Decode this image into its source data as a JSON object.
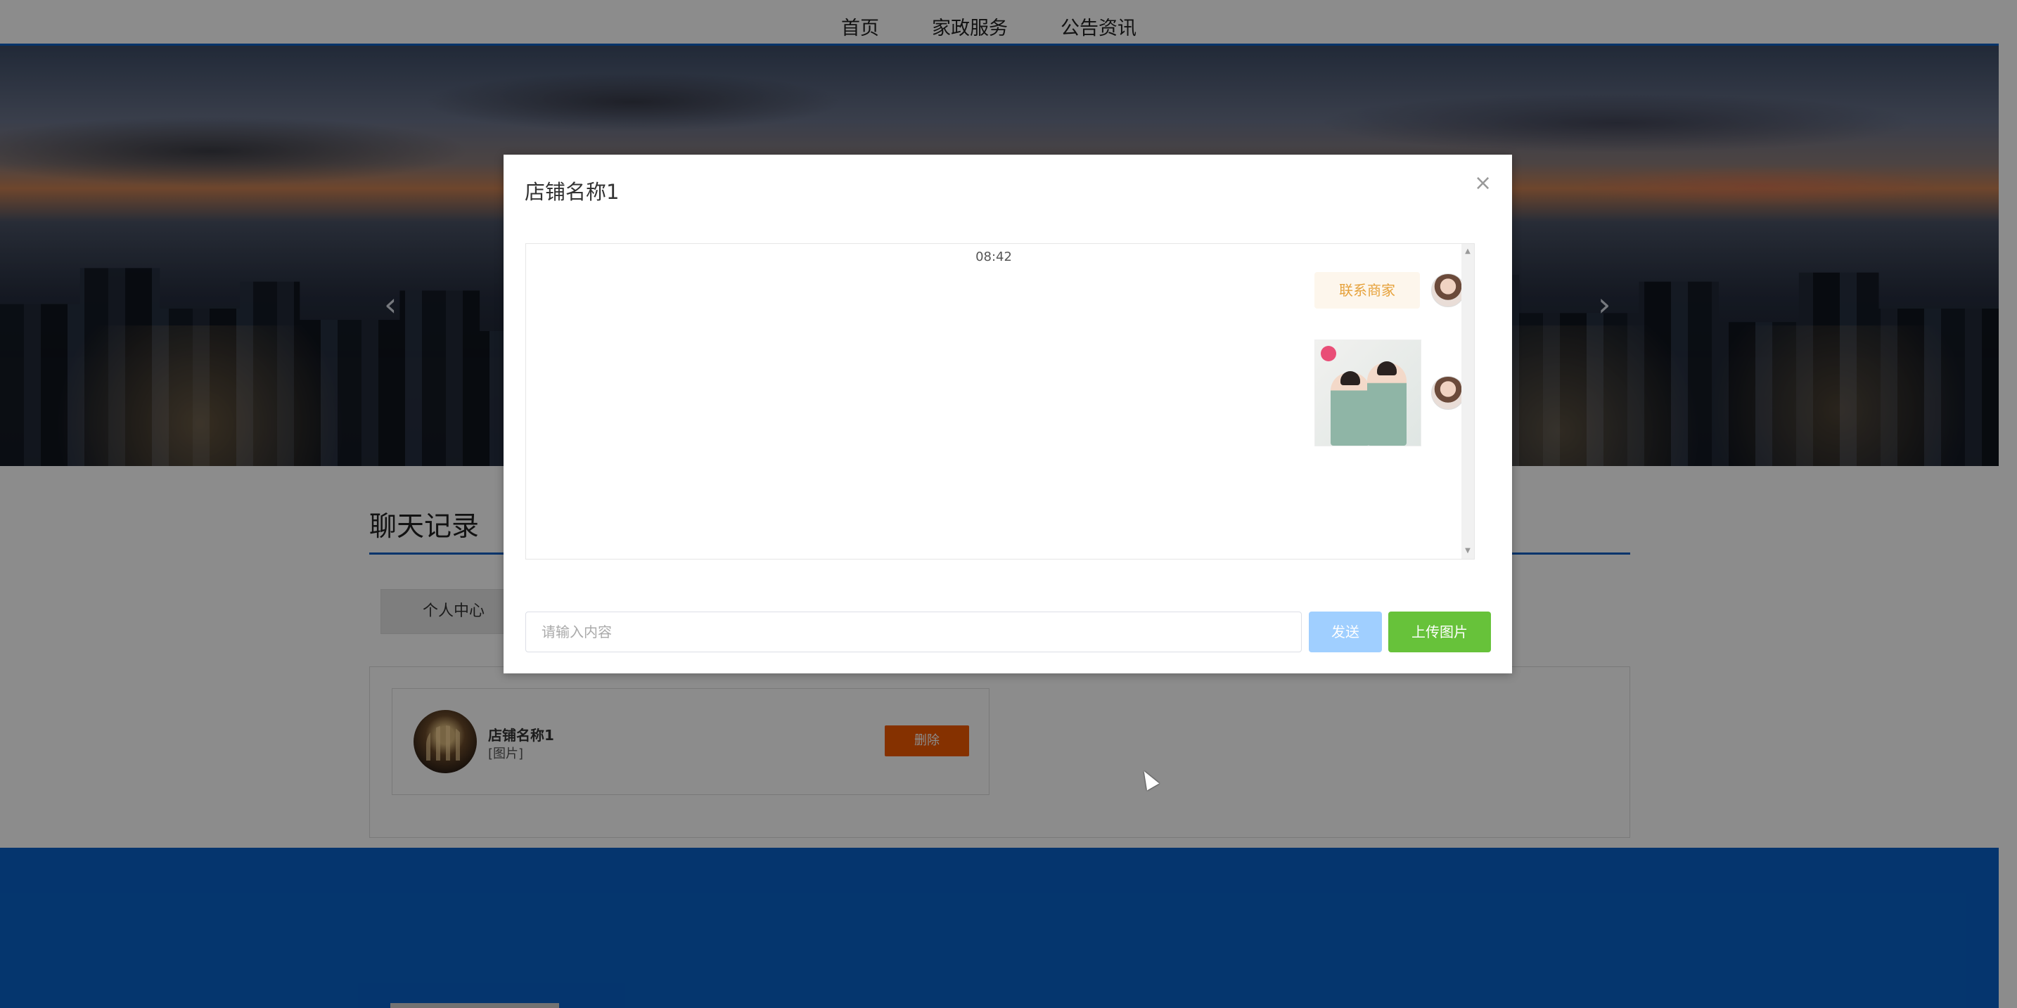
{
  "nav": {
    "items": [
      {
        "label": "首页"
      },
      {
        "label": "家政服务"
      },
      {
        "label": "公告资讯"
      }
    ]
  },
  "banner": {
    "prev_arrow": "‹",
    "next_arrow": "›"
  },
  "page": {
    "section_title": "聊天记录",
    "tab_label": "个人中心"
  },
  "chat_list": {
    "item": {
      "name": "店铺名称1",
      "preview": "[图片]",
      "delete_label": "删除"
    }
  },
  "modal": {
    "title": "店铺名称1",
    "close_glyph": "×",
    "time": "08:42",
    "messages": [
      {
        "type": "text",
        "text": "联系商家"
      },
      {
        "type": "image"
      }
    ],
    "input_placeholder": "请输入内容",
    "send_label": "发送",
    "upload_label": "上传图片"
  },
  "colors": {
    "nav_accent": "#0a5fc4",
    "footer": "#0a62c9",
    "delete": "#f25a00",
    "send": "#a0cfff",
    "upload": "#67c23a",
    "msg_bubble_text": "#e6a23c"
  }
}
